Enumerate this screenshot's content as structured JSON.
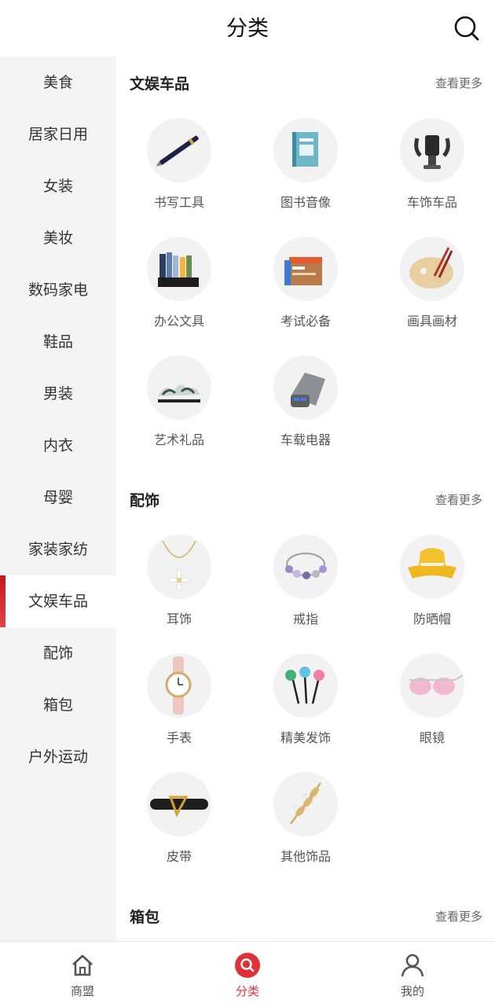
{
  "header": {
    "title": "分类",
    "search_icon": "search-icon"
  },
  "sidebar": {
    "active_index": 10,
    "accent_color": "#c8161d",
    "items": [
      {
        "label": "美食"
      },
      {
        "label": "居家日用"
      },
      {
        "label": "女装"
      },
      {
        "label": "美妆"
      },
      {
        "label": "数码家电"
      },
      {
        "label": "鞋品"
      },
      {
        "label": "男装"
      },
      {
        "label": "内衣"
      },
      {
        "label": "母婴"
      },
      {
        "label": "家装家纺"
      },
      {
        "label": "文娱车品"
      },
      {
        "label": "配饰"
      },
      {
        "label": "箱包"
      },
      {
        "label": "户外运动"
      }
    ]
  },
  "sections": [
    {
      "title": "文娱车品",
      "more": "查看更多",
      "items": [
        {
          "label": "书写工具",
          "icon": "pen-icon"
        },
        {
          "label": "图书音像",
          "icon": "book-icon"
        },
        {
          "label": "车饰车品",
          "icon": "phone-holder-icon"
        },
        {
          "label": "办公文具",
          "icon": "file-organizer-icon"
        },
        {
          "label": "考试必备",
          "icon": "exam-books-icon"
        },
        {
          "label": "画具画材",
          "icon": "palette-icon"
        },
        {
          "label": "艺术礼品",
          "icon": "art-gift-icon"
        },
        {
          "label": "车载电器",
          "icon": "car-charger-icon"
        }
      ]
    },
    {
      "title": "配饰",
      "more": "查看更多",
      "items": [
        {
          "label": "耳饰",
          "icon": "necklace-icon"
        },
        {
          "label": "戒指",
          "icon": "bracelet-icon"
        },
        {
          "label": "防晒帽",
          "icon": "bucket-hat-icon"
        },
        {
          "label": "手表",
          "icon": "watch-icon"
        },
        {
          "label": "精美发饰",
          "icon": "hairpin-icon"
        },
        {
          "label": "眼镜",
          "icon": "sunglasses-icon"
        },
        {
          "label": "皮带",
          "icon": "belt-icon"
        },
        {
          "label": "其他饰品",
          "icon": "brooch-icon"
        }
      ]
    },
    {
      "title": "箱包",
      "more": "查看更多",
      "items": []
    }
  ],
  "bottom_nav": {
    "active_index": 1,
    "active_color": "#e0303a",
    "tabs": [
      {
        "label": "商盟",
        "icon": "home-icon"
      },
      {
        "label": "分类",
        "icon": "category-search-icon"
      },
      {
        "label": "我的",
        "icon": "user-icon"
      }
    ]
  }
}
